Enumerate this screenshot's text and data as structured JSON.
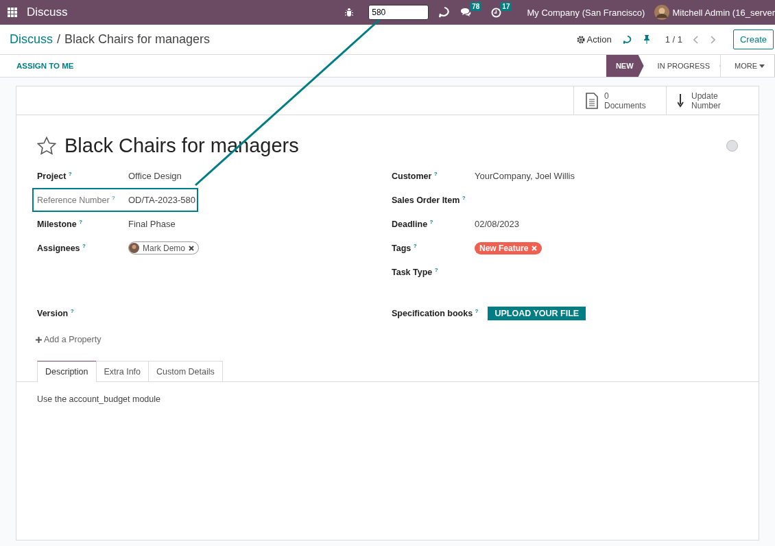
{
  "topbar": {
    "app_name": "Discuss",
    "search_value": "580",
    "chat_count": "78",
    "activity_count": "17",
    "company": "My Company (San Francisco)",
    "user": "Mitchell Admin (16_server"
  },
  "breadcrumb": {
    "parent": "Discuss",
    "separator": "/",
    "current": "Black Chairs for managers"
  },
  "control_panel": {
    "action": "Action",
    "pager": "1 / 1",
    "create": "Create"
  },
  "status_bar": {
    "assign": "ASSIGN TO ME",
    "stages": [
      {
        "label": "NEW",
        "selected": true
      },
      {
        "label": "IN PROGRESS",
        "selected": false
      }
    ],
    "more": "MORE"
  },
  "button_box": [
    {
      "kind": "documents",
      "count": "0",
      "label": "Documents"
    },
    {
      "kind": "sort",
      "count": "Update",
      "label": "Number"
    }
  ],
  "title": "Black Chairs for managers",
  "starred": false,
  "columns": [
    {
      "fields": [
        {
          "label": "Project $^{?}$",
          "value": "Office Design",
          "kind": "text",
          "highlighted": false
        },
        {
          "label": "Reference Number $^{?}$",
          "value": "OD/TA-2023-580",
          "kind": "text",
          "highlighted": true
        },
        {
          "label": "Milestone $^{?}$",
          "value": "Final Phase",
          "kind": "text",
          "highlighted": false
        },
        {
          "label": "Assignees $^{?}$",
          "value": "Mark Demo",
          "kind": "person",
          "highlighted": false
        }
      ],
      "extra": [
        {
          "label": "Version $^{?}$",
          "kind": "empty"
        }
      ]
    },
    {
      "fields": [
        {
          "label": "Customer $^{?}$",
          "value": "YourCompany, Joel Willis",
          "kind": "text",
          "highlighted": false
        },
        {
          "label": "Sales Order Item $^{?}$",
          "kind": "empty",
          "highlighted": false
        },
        {
          "label": "Deadline $^{?}$",
          "value": "02/08/2023",
          "kind": "text",
          "highlighted": false
        },
        {
          "label": "Tags $^{?}$",
          "value": "New Feature",
          "kind": "tag",
          "color": "#f06050",
          "highlighted": false
        },
        {
          "label": "Task Type $^{?}$",
          "kind": "empty",
          "highlighted": false
        }
      ],
      "extra": [
        {
          "label": "Specification books $^{?}$",
          "value": "UPLOAD YOUR FILE",
          "kind": "upload"
        }
      ]
    }
  ],
  "add_property": "Add a Property",
  "tabs": [
    {
      "label": "Description",
      "selected": true
    },
    {
      "label": "Extra Info",
      "selected": false
    },
    {
      "label": "Custom Details",
      "selected": false
    }
  ],
  "description": "Use the account_budget module"
}
